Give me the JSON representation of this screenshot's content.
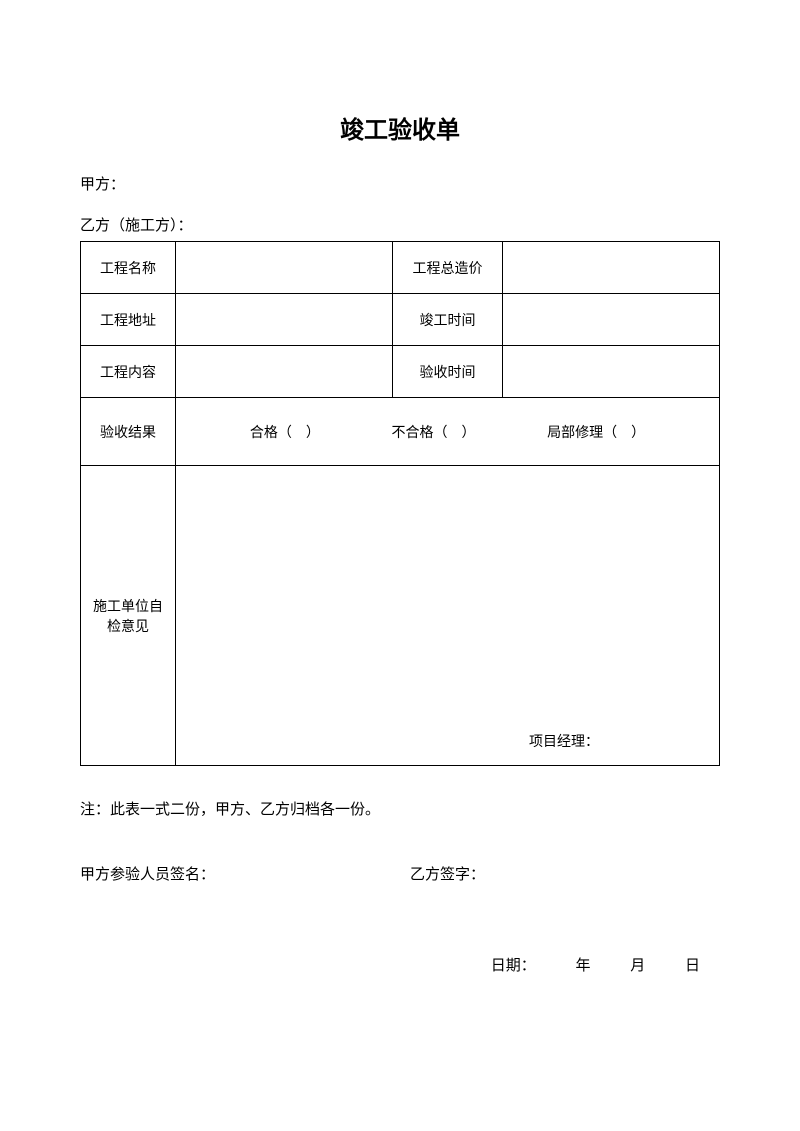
{
  "title": "竣工验收单",
  "partyA": "甲方：",
  "partyB": "乙方（施工方）：",
  "labels": {
    "projectName": "工程名称",
    "totalCost": "工程总造价",
    "projectAddr": "工程地址",
    "completeTime": "竣工时间",
    "projectContent": "工程内容",
    "acceptTime": "验收时间",
    "acceptResult": "验收结果",
    "selfOpinion": "施工单位自检意见",
    "projectManager": "项目经理："
  },
  "resultOptions": {
    "pass": "合格（ ）",
    "fail": "不合格（ ）",
    "partial": "局部修理（ ）"
  },
  "note": "注：此表一式二份，甲方、乙方归档各一份。",
  "signA": "甲方参验人员签名：",
  "signB": "乙方签字：",
  "date": {
    "prefix": "日期：",
    "year": "年",
    "month": "月",
    "day": "日"
  }
}
